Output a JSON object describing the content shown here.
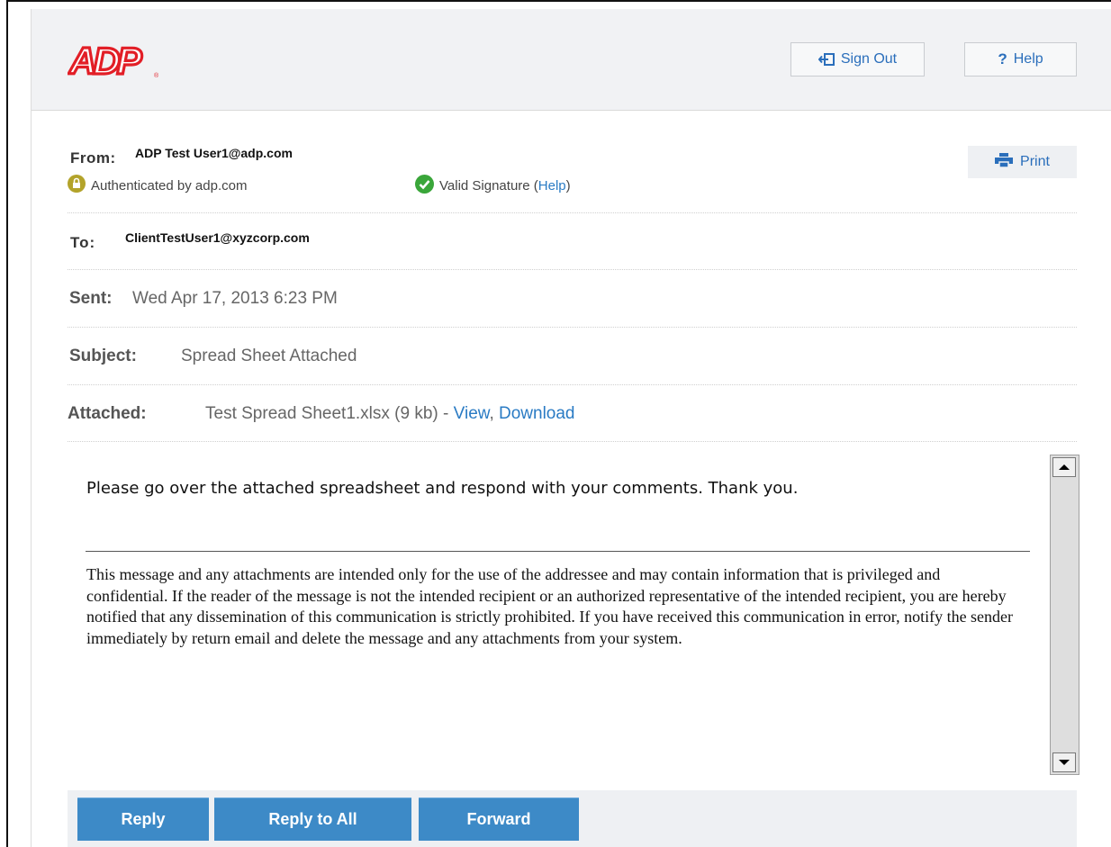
{
  "header": {
    "logo_text": "ADP",
    "sign_out_label": "Sign Out",
    "help_label": "Help"
  },
  "message": {
    "from_label": "From:",
    "from_value": "ADP Test User1@adp.com",
    "authenticated_text": "Authenticated by adp.com",
    "valid_signature_text": "Valid Signature",
    "valid_signature_help": "Help",
    "print_label": "Print",
    "to_label": "To:",
    "to_value": "ClientTestUser1@xyzcorp.com",
    "sent_label": "Sent:",
    "sent_value": "Wed Apr 17, 2013 6:23 PM",
    "subject_label": "Subject:",
    "subject_value": "Spread Sheet Attached",
    "attached_label": "Attached:",
    "attachment_name": "Test Spread Sheet1.xlsx (9 kb)",
    "attachment_sep": "-",
    "view_label": "View",
    "download_label": "Download",
    "body_text": "Please go over the attached spreadsheet and respond with your comments. Thank you.",
    "disclaimer_text": "This message and any attachments are intended only for the use of the addressee and may contain information that is privileged and confidential. If the reader of the message is not the intended recipient or an authorized representative of the intended recipient, you are hereby notified that any dissemination of this communication is strictly prohibited. If you have received this communication in error, notify the sender immediately by return email and delete the message and any attachments from your system."
  },
  "actions": {
    "reply_label": "Reply",
    "reply_all_label": "Reply to All",
    "forward_label": "Forward"
  },
  "colors": {
    "brand_red": "#e21e26",
    "link_blue": "#2a7bc4",
    "button_blue": "#3d8ac7",
    "lock_yellow": "#b3a32a",
    "check_green": "#3aa63a"
  },
  "icons": {
    "sign_out": "sign-out-icon",
    "help": "question-mark-icon",
    "print": "printer-icon",
    "lock": "lock-icon",
    "check": "check-circle-icon",
    "scroll_up": "scroll-up-arrow-icon",
    "scroll_down": "scroll-down-arrow-icon"
  }
}
